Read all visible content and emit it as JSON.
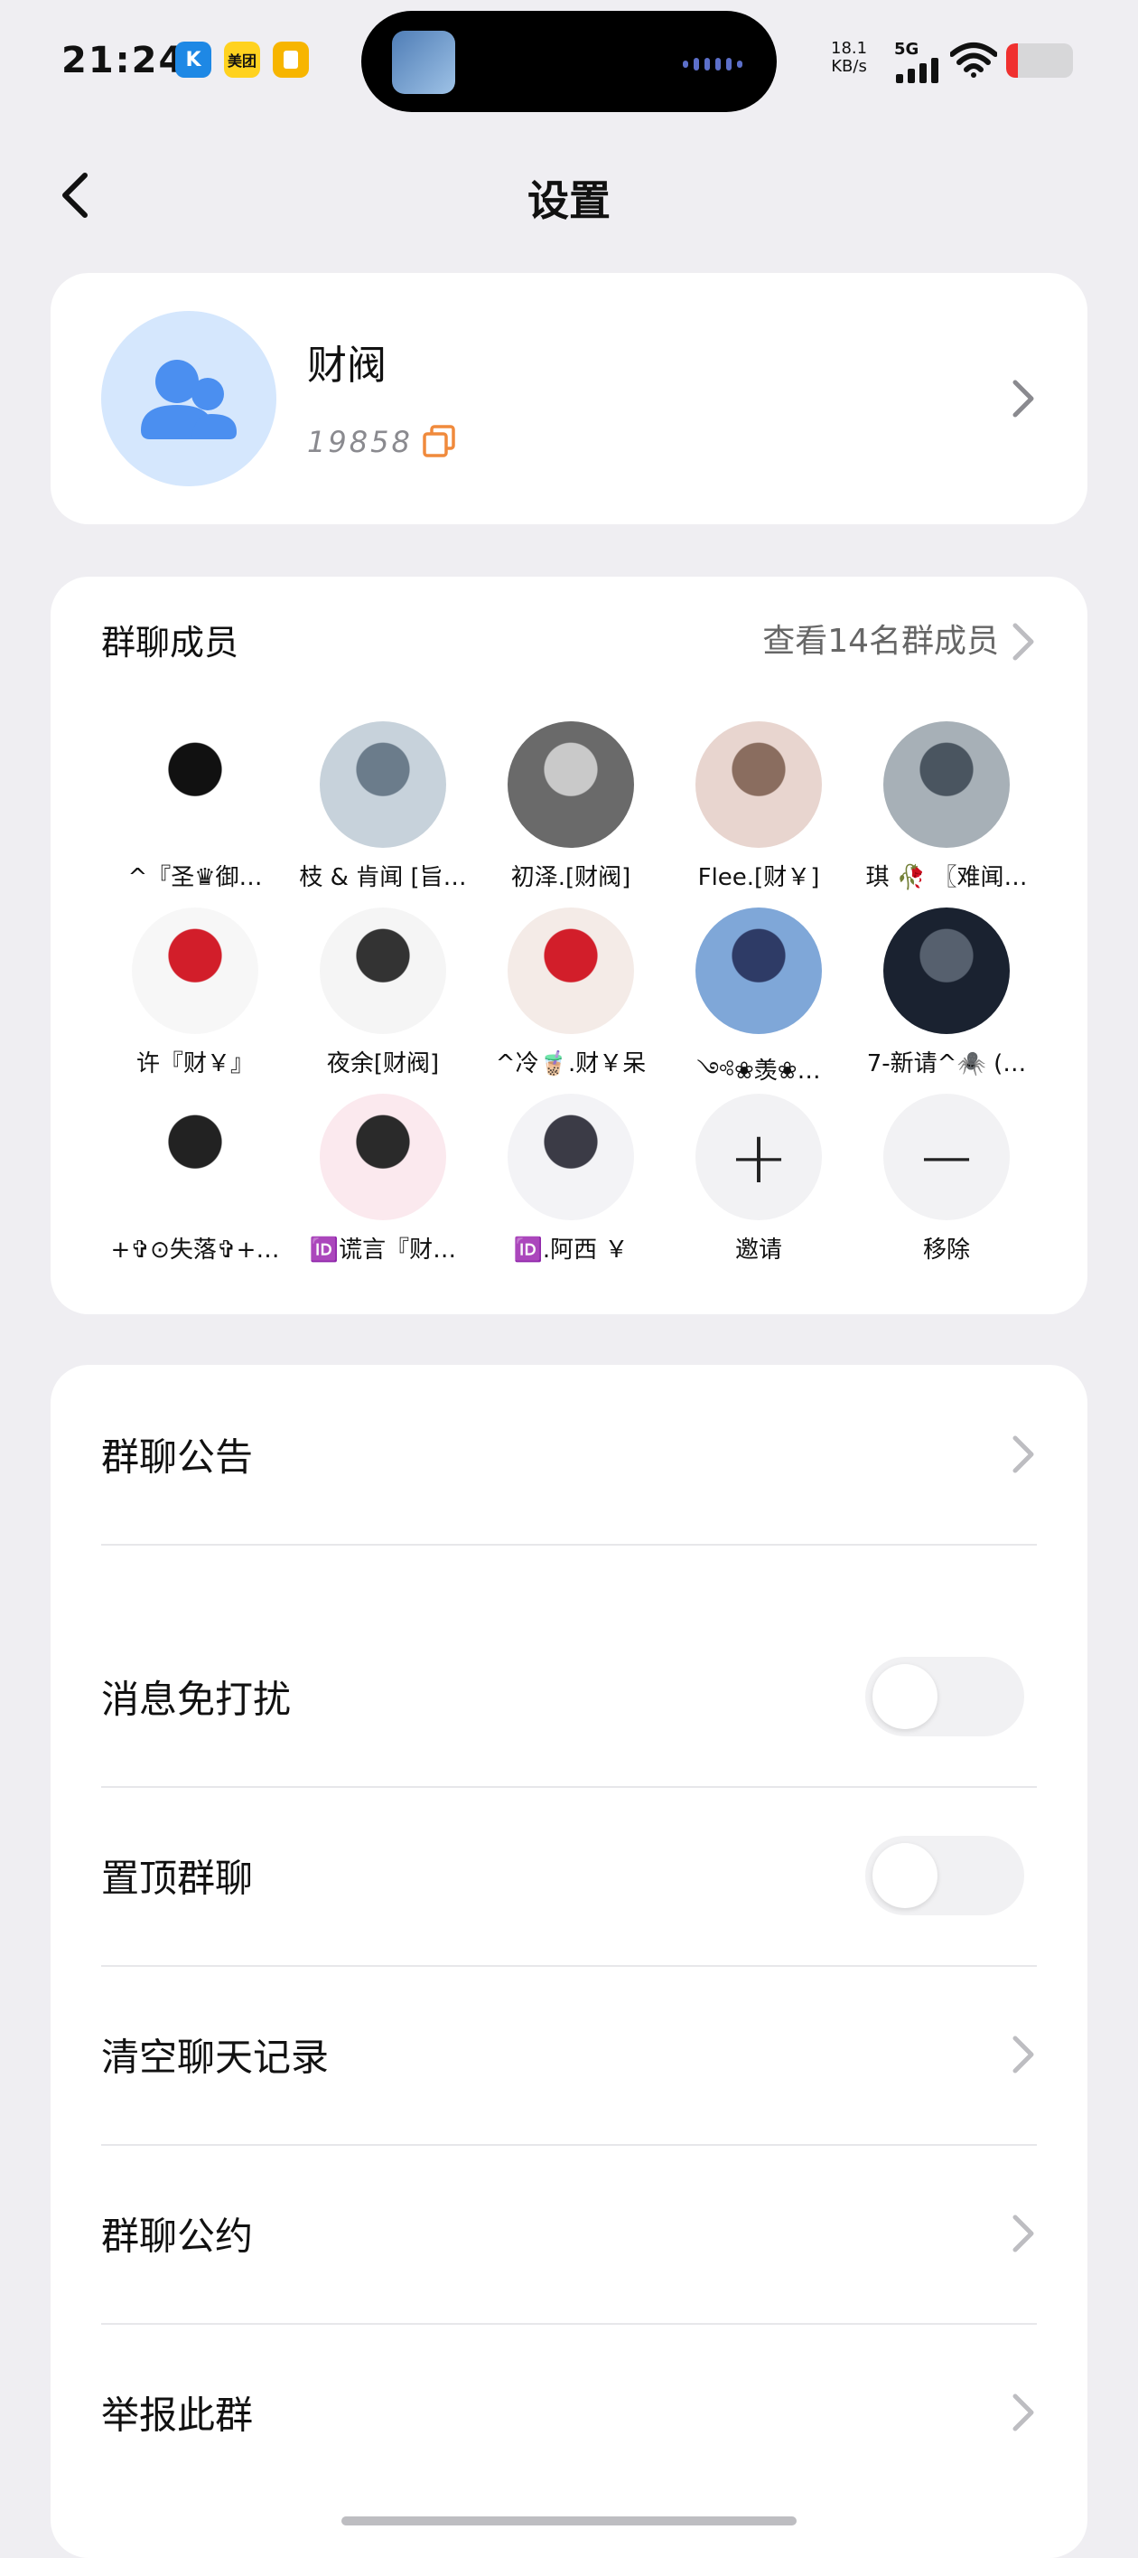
{
  "status_bar": {
    "time": "21:24",
    "apps": [
      {
        "name": "k-app",
        "label": "K",
        "color": "#1e88e5"
      },
      {
        "name": "meituan-app",
        "label": "美团",
        "color": "#ffd21f"
      },
      {
        "name": "notes-app",
        "label": "",
        "color": "#f7b500"
      }
    ],
    "net_speed": "18.1",
    "net_unit": "KB/s",
    "signal": "5G",
    "battery_level": 0.18
  },
  "nav": {
    "back_icon": "chevron-left-icon",
    "title": "设置"
  },
  "group": {
    "name": "财阀",
    "id": "19858",
    "avatar_color": "#d5e7fd",
    "icon_color": "#4b8ff0",
    "copy_icon_color": "#f08a3c"
  },
  "members": {
    "title": "群聊成员",
    "view_all": "查看14名群成员",
    "list": [
      {
        "name": "^『圣♛御…",
        "avatar_colors": [
          "#ffffff",
          "#111111"
        ]
      },
      {
        "name": "枝 & 肯闻 [旨…",
        "avatar_colors": [
          "#c7d2db",
          "#6b7c8b"
        ]
      },
      {
        "name": "初泽.[财阀]",
        "avatar_colors": [
          "#6a6a6a",
          "#c9c9c9"
        ]
      },
      {
        "name": "Flee.[财￥]",
        "avatar_colors": [
          "#e8d5cf",
          "#8a6d5f"
        ]
      },
      {
        "name": "琪 🥀 〖难闻…",
        "avatar_colors": [
          "#a7b0b7",
          "#4a5560"
        ]
      },
      {
        "name": "许『财￥』",
        "avatar_colors": [
          "#f7f7f7",
          "#d21e2a"
        ]
      },
      {
        "name": "夜余[财阀]",
        "avatar_colors": [
          "#f5f5f5",
          "#333333"
        ]
      },
      {
        "name": "^冷🧋.财￥呆",
        "avatar_colors": [
          "#f4ebe7",
          "#d21e2a"
        ]
      },
      {
        "name": "༺❀羡❀…",
        "avatar_colors": [
          "#7fa7d8",
          "#2e3b66"
        ]
      },
      {
        "name": "7-新请^🕷️ (…",
        "avatar_colors": [
          "#1a2230",
          "#56606e"
        ]
      },
      {
        "name": "+✞⊙失落✞+…",
        "avatar_colors": [
          "#ffffff",
          "#222222"
        ]
      },
      {
        "name": "🆔谎言『财…",
        "avatar_colors": [
          "#fbe9ee",
          "#2a2a2a"
        ]
      },
      {
        "name": "🆔.阿西 ￥",
        "avatar_colors": [
          "#f3f3f6",
          "#3b3b46"
        ]
      }
    ],
    "invite_label": "邀请",
    "remove_label": "移除"
  },
  "settings": {
    "rows": [
      {
        "label": "群聊公告",
        "type": "link"
      },
      {
        "label": "消息免打扰",
        "type": "toggle",
        "on": false
      },
      {
        "label": "置顶群聊",
        "type": "toggle",
        "on": false
      },
      {
        "label": "清空聊天记录",
        "type": "link"
      },
      {
        "label": "群聊公约",
        "type": "link"
      },
      {
        "label": "举报此群",
        "type": "link"
      }
    ]
  }
}
